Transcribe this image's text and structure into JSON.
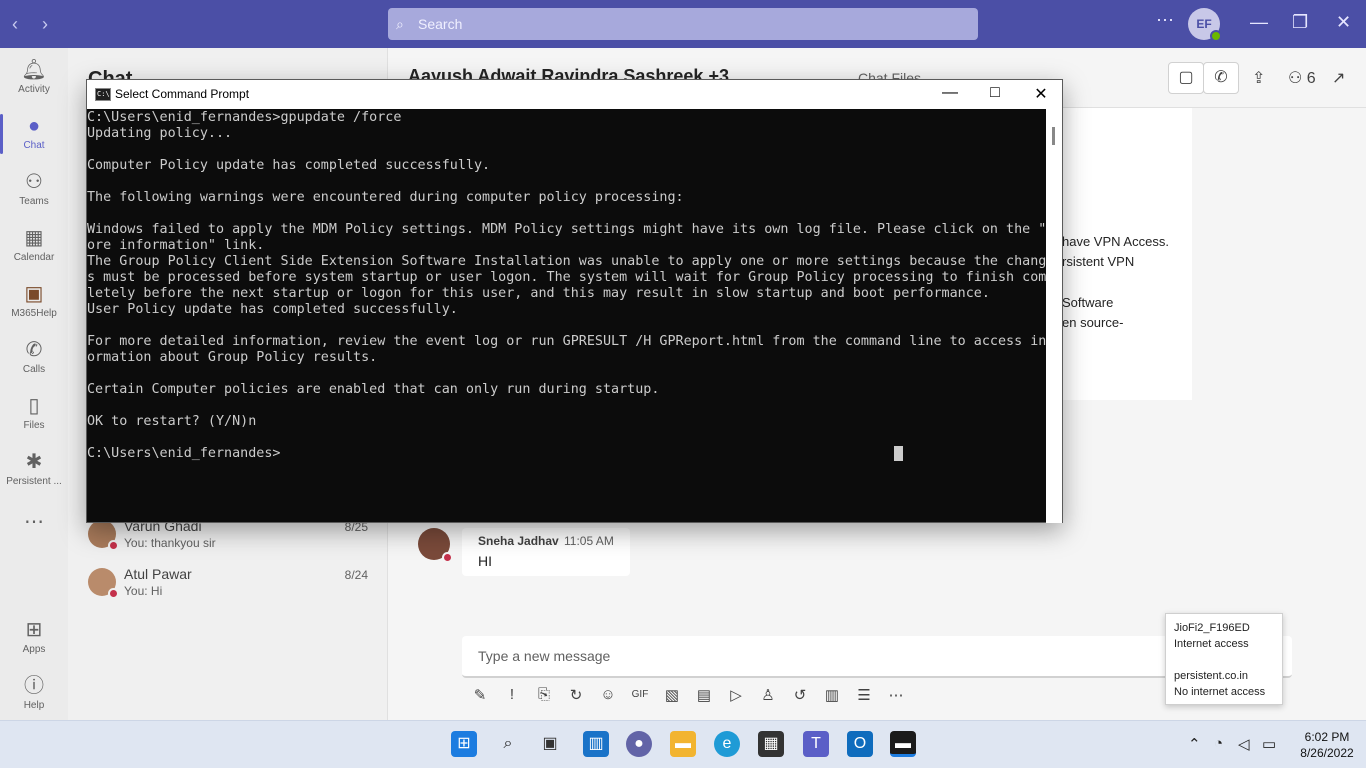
{
  "teams": {
    "search_placeholder": "Search",
    "profile_initials": "EF",
    "rail": [
      {
        "label": "Activity",
        "icon": "bell-icon"
      },
      {
        "label": "Chat",
        "icon": "chat-icon"
      },
      {
        "label": "Teams",
        "icon": "teams-icon"
      },
      {
        "label": "Calendar",
        "icon": "calendar-icon"
      },
      {
        "label": "M365Help",
        "icon": "m365help-icon"
      },
      {
        "label": "Calls",
        "icon": "phone-icon"
      },
      {
        "label": "Files",
        "icon": "file-icon"
      },
      {
        "label": "Persistent ...",
        "icon": "persistent-icon"
      },
      {
        "label": "Apps",
        "icon": "apps-icon"
      },
      {
        "label": "Help",
        "icon": "help-icon"
      }
    ],
    "chatlist": {
      "header": "Chat",
      "items": [
        {
          "name": "Varun Ghadi",
          "preview": "You: thankyou sir",
          "date": "8/25"
        },
        {
          "name": "Atul Pawar",
          "preview": "You: Hi",
          "date": "8/24"
        }
      ]
    },
    "conversation": {
      "title": "Aayush  Adwait Ravindra  Sashreek  +3",
      "tabs": "Chat    Files",
      "participants_count": "6",
      "card_lines": [
        "have VPN Access.",
        "rsistent VPN",
        "Software",
        "en source-"
      ],
      "message": {
        "author": "Sneha Jadhav",
        "time": "11:05 AM",
        "text": "HI"
      },
      "composer_placeholder": "Type a new message"
    }
  },
  "cmd": {
    "title": "Select Command Prompt",
    "lines": [
      "C:\\Users\\enid_fernandes>gpupdate /force",
      "Updating policy...",
      "",
      "Computer Policy update has completed successfully.",
      "",
      "The following warnings were encountered during computer policy processing:",
      "",
      "Windows failed to apply the MDM Policy settings. MDM Policy settings might have its own log file. Please click on the \"M",
      "ore information\" link.",
      "The Group Policy Client Side Extension Software Installation was unable to apply one or more settings because the change",
      "s must be processed before system startup or user logon. The system will wait for Group Policy processing to finish comp",
      "letely before the next startup or logon for this user, and this may result in slow startup and boot performance.",
      "User Policy update has completed successfully.",
      "",
      "For more detailed information, review the event log or run GPRESULT /H GPReport.html from the command line to access inf",
      "ormation about Group Policy results.",
      "",
      "Certain Computer policies are enabled that can only run during startup.",
      "",
      "OK to restart? (Y/N)n",
      "",
      "C:\\Users\\enid_fernandes>"
    ]
  },
  "network_flyout": {
    "network1": "JioFi2_F196ED",
    "status1": "Internet access",
    "network2": "persistent.co.in",
    "status2": "No internet access"
  },
  "taskbar": {
    "time": "6:02 PM",
    "date": "8/26/2022"
  }
}
